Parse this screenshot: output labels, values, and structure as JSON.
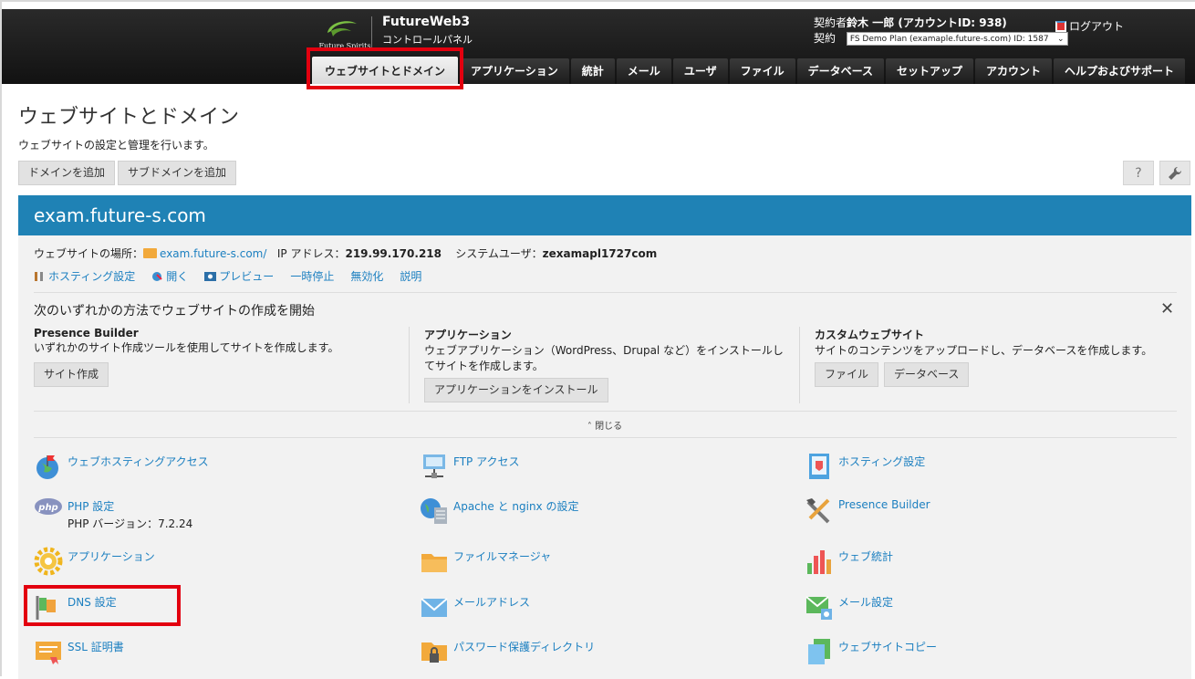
{
  "header": {
    "logo_caption": "Future Spirits",
    "brand_title": "FutureWeb3",
    "brand_sub": "コントロールパネル",
    "account_prefix": "契約者",
    "account_name": "鈴木 一郎 (アカウントID: 938)",
    "plan_label": "契約",
    "plan_value": "FS Demo Plan (examaple.future-s.com) ID: 1587",
    "logout": "ログアウト"
  },
  "nav": {
    "tabs": [
      "ウェブサイトとドメイン",
      "アプリケーション",
      "統計",
      "メール",
      "ユーザ",
      "ファイル",
      "データベース",
      "セットアップ",
      "アカウント",
      "ヘルプおよびサポート"
    ]
  },
  "page": {
    "title": "ウェブサイトとドメイン",
    "description": "ウェブサイトの設定と管理を行います。",
    "add_domain": "ドメインを追加",
    "add_subdomain": "サブドメインを追加",
    "help": "?"
  },
  "domain": {
    "name": "exam.future-s.com",
    "location_label": "ウェブサイトの場所：",
    "location_link": "exam.future-s.com/",
    "ip_label": "IP アドレス：",
    "ip": "219.99.170.218",
    "sysuser_label": "システムユーザ：",
    "sysuser": "zexamapl1727com",
    "actions": [
      "ホスティング設定",
      "開く",
      "プレビュー",
      "一時停止",
      "無効化",
      "説明"
    ]
  },
  "start": {
    "title": "次のいずれかの方法でウェブサイトの作成を開始",
    "close": "✕",
    "col1_title": "Presence Builder",
    "col1_desc": "いずれかのサイト作成ツールを使用してサイトを作成します。",
    "col1_btn": "サイト作成",
    "col2_title": "アプリケーション",
    "col2_desc": "ウェブアプリケーション（WordPress、Drupal など）をインストールしてサイトを作成します。",
    "col2_btn": "アプリケーションをインストール",
    "col3_title": "カスタムウェブサイト",
    "col3_desc": "サイトのコンテンツをアップロードし、データベースを作成します。",
    "col3_btn1": "ファイル",
    "col3_btn2": "データベース",
    "collapse": "˄ 閉じる"
  },
  "tools": {
    "web_hosting_access": "ウェブホスティングアクセス",
    "ftp_access": "FTP アクセス",
    "hosting_settings": "ホスティング設定",
    "php_settings": "PHP 設定",
    "php_version": "PHP バージョン：7.2.24",
    "apache_nginx": "Apache と nginx の設定",
    "presence_builder": "Presence Builder",
    "applications": "アプリケーション",
    "file_manager": "ファイルマネージャ",
    "web_stats": "ウェブ統計",
    "dns_settings": "DNS 設定",
    "mail_addresses": "メールアドレス",
    "mail_settings": "メール設定",
    "ssl": "SSL 証明書",
    "password_dirs": "パスワード保護ディレクトリ",
    "website_copy": "ウェブサイトコピー"
  },
  "colors": {
    "accent": "#1f82b5",
    "link": "#1b7fc0",
    "highlight": "#e3000f"
  }
}
